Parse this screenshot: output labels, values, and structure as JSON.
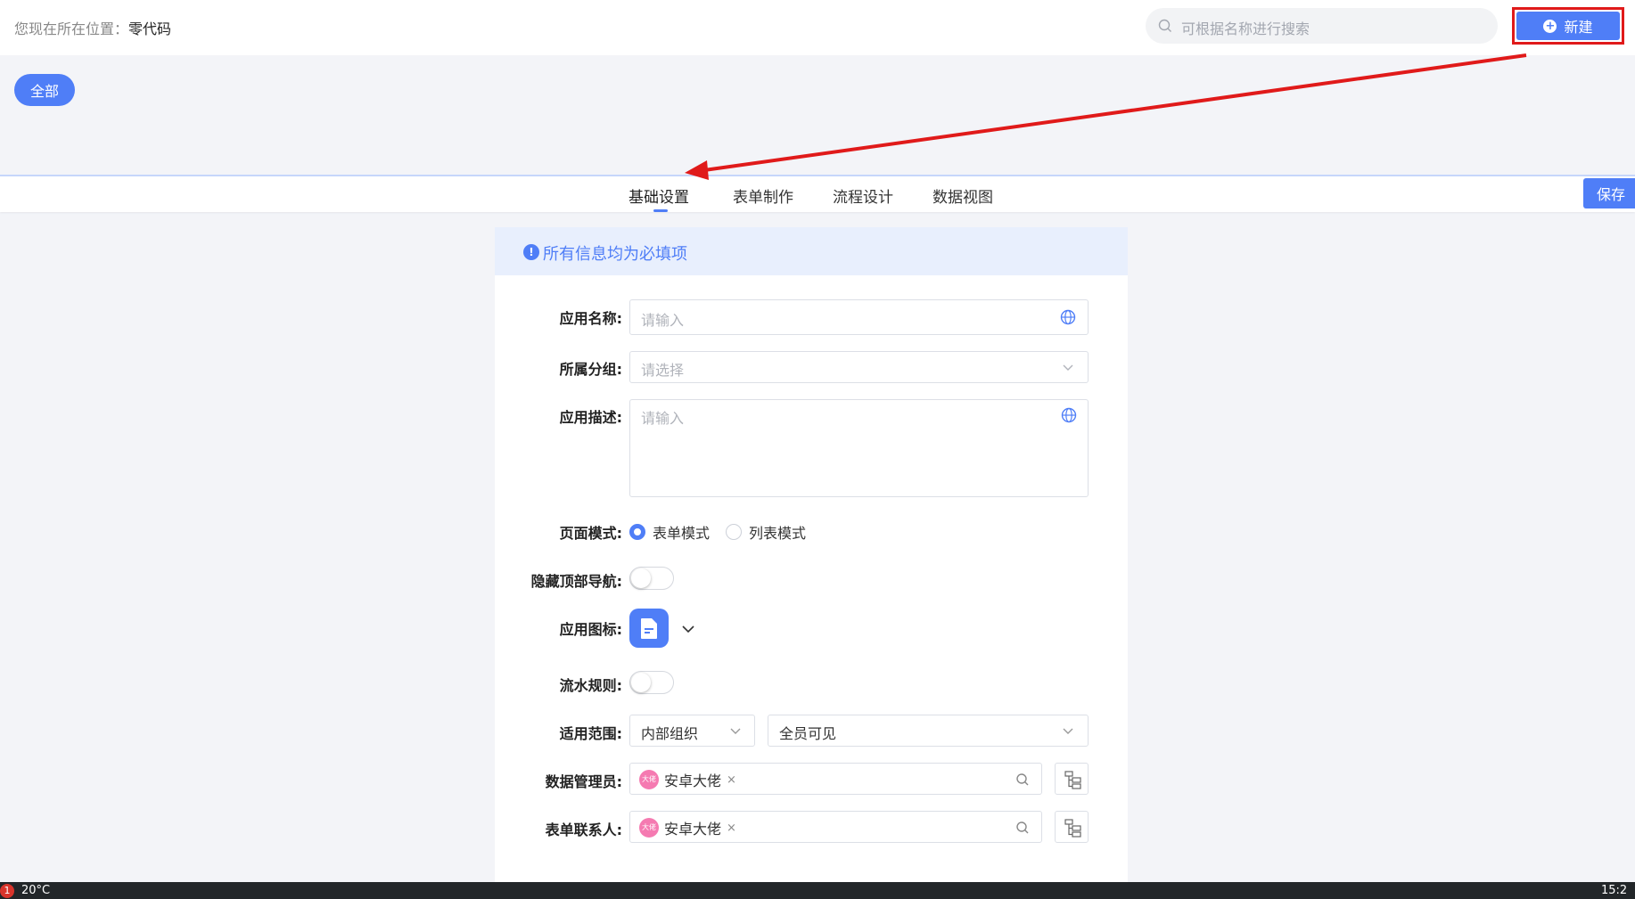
{
  "breadcrumb": {
    "prefix": "您现在所在位置：",
    "current": "零代码"
  },
  "search": {
    "placeholder": "可根据名称进行搜索"
  },
  "header": {
    "new_label": "新建"
  },
  "filters": {
    "all_label": "全部"
  },
  "tabs": [
    "基础设置",
    "表单制作",
    "流程设计",
    "数据视图"
  ],
  "save_label": "保存",
  "notice": "所有信息均为必填项",
  "form": {
    "app_name": {
      "label": "应用名称:",
      "placeholder": "请输入"
    },
    "group": {
      "label": "所属分组:",
      "placeholder": "请选择"
    },
    "description": {
      "label": "应用描述:",
      "placeholder": "请输入"
    },
    "page_mode": {
      "label": "页面模式:",
      "options": [
        "表单模式",
        "列表模式"
      ],
      "selected": "表单模式"
    },
    "hide_nav": {
      "label": "隐藏顶部导航:",
      "on": false
    },
    "app_icon": {
      "label": "应用图标:",
      "icon": "document-icon"
    },
    "serial_rule": {
      "label": "流水规则:",
      "on": false
    },
    "scope": {
      "label": "适用范围:",
      "org": "内部组织",
      "visibility": "全员可见"
    },
    "data_admin": {
      "label": "数据管理员:",
      "avatar_text": "大佬",
      "user": "安卓大佬"
    },
    "form_contact": {
      "label": "表单联系人:",
      "avatar_text": "大佬",
      "user": "安卓大佬"
    }
  },
  "taskbar": {
    "badge": "1",
    "temp": "20°C",
    "time": "15:2"
  },
  "colors": {
    "accent": "#4f7ef7",
    "annotation": "#e01a1a"
  }
}
